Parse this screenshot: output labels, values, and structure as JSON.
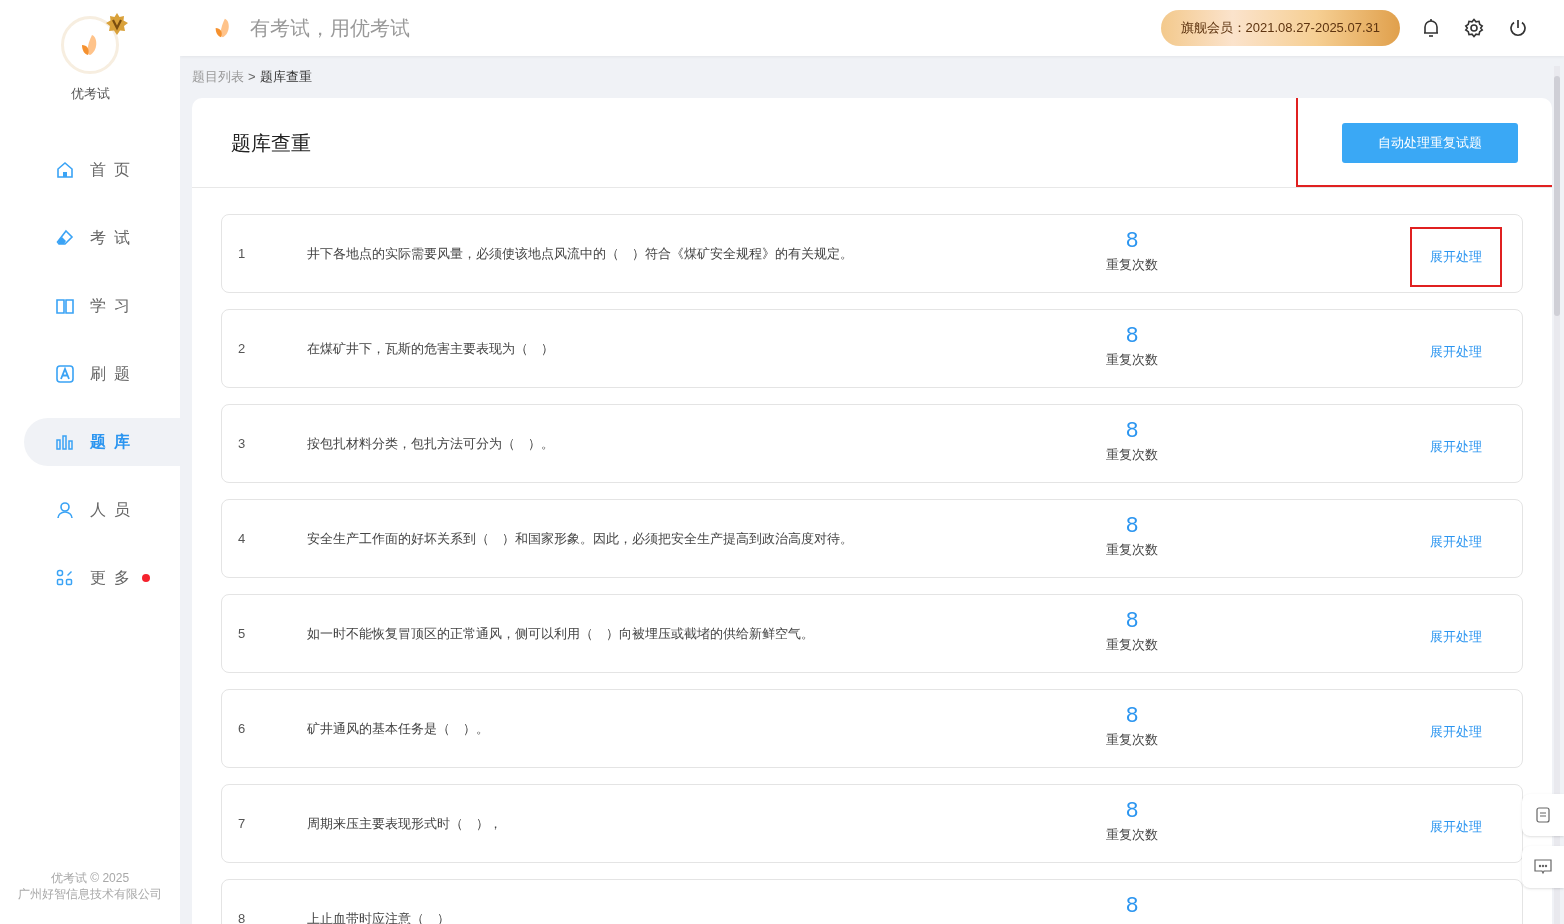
{
  "brand": {
    "name": "优考试"
  },
  "header": {
    "slogan": "有考试，用优考试",
    "membership": "旗舰会员：2021.08.27-2025.07.31"
  },
  "sidebar": {
    "items": [
      {
        "label": "首 页",
        "selected": false,
        "badge": false
      },
      {
        "label": "考 试",
        "selected": false,
        "badge": false
      },
      {
        "label": "学 习",
        "selected": false,
        "badge": false
      },
      {
        "label": "刷 题",
        "selected": false,
        "badge": false
      },
      {
        "label": "题 库",
        "selected": true,
        "badge": false
      },
      {
        "label": "人 员",
        "selected": false,
        "badge": false
      },
      {
        "label": "更 多",
        "selected": false,
        "badge": true
      }
    ],
    "footer": [
      "优考试 © 2025",
      "广州好智信息技术有限公司"
    ]
  },
  "breadcrumb": {
    "parent": "题目列表",
    "separator": ">",
    "current": "题库查重"
  },
  "page": {
    "title": "题库查重",
    "auto_button": {
      "label": "自动处理重复试题",
      "highlighted": true
    }
  },
  "rows": [
    {
      "index": "1",
      "question": "井下各地点的实际需要风量，必须使该地点风流中的（　）符合《煤矿安全规程》的有关规定。",
      "count": "8",
      "count_label": "重复次数",
      "action": "展开处理",
      "highlighted": true
    },
    {
      "index": "2",
      "question": "在煤矿井下，瓦斯的危害主要表现为（　）",
      "count": "8",
      "count_label": "重复次数",
      "action": "展开处理",
      "highlighted": false
    },
    {
      "index": "3",
      "question": "按包扎材料分类，包扎方法可分为（　）。",
      "count": "8",
      "count_label": "重复次数",
      "action": "展开处理",
      "highlighted": false
    },
    {
      "index": "4",
      "question": "安全生产工作面的好坏关系到（　）和国家形象。因此，必须把安全生产提高到政治高度对待。",
      "count": "8",
      "count_label": "重复次数",
      "action": "展开处理",
      "highlighted": false
    },
    {
      "index": "5",
      "question": "如一时不能恢复冒顶区的正常通风，侧可以利用（　）向被埋压或截堵的供给新鲜空气。",
      "count": "8",
      "count_label": "重复次数",
      "action": "展开处理",
      "highlighted": false
    },
    {
      "index": "6",
      "question": "矿井通风的基本任务是（　）。",
      "count": "8",
      "count_label": "重复次数",
      "action": "展开处理",
      "highlighted": false
    },
    {
      "index": "7",
      "question": "周期来压主要表现形式时（　），",
      "count": "8",
      "count_label": "重复次数",
      "action": "展开处理",
      "highlighted": false
    },
    {
      "index": "8",
      "question": "上止血带时应注意（　）",
      "count": "8",
      "highlighted": false
    }
  ]
}
